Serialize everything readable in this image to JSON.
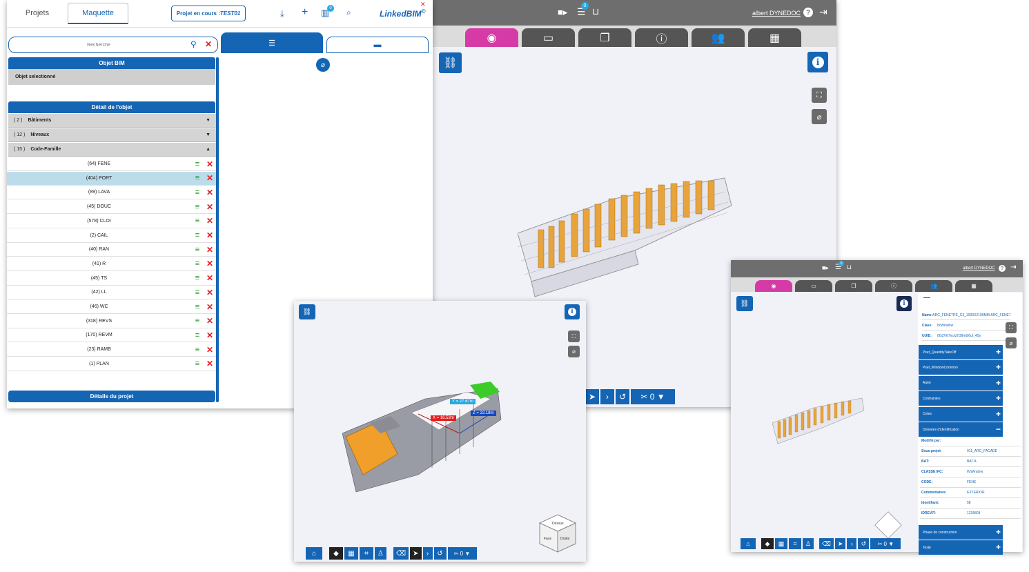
{
  "left_panel": {
    "tab_projets": "Projets",
    "tab_maquette": "Maquette",
    "current_project_label": "Projet en cours : ",
    "current_project_value": "TEST01",
    "model_badge_count": "0",
    "brand": "LinkedBIM",
    "brand_mark": "©",
    "search_placeholder": "Recherche",
    "objet_bim_header": "Objet BIM",
    "objet_selectionne": "Objet selectionné",
    "detail_header": "Détail de l'objet",
    "groups": [
      {
        "count": "( 2 )",
        "label": "Bâtiments",
        "caret": "▼"
      },
      {
        "count": "( 12 )",
        "label": "Niveaux",
        "caret": "▼"
      },
      {
        "count": "( 15 )",
        "label": "Code-Famille",
        "caret": "▲"
      }
    ],
    "families": [
      "(64) FENE",
      "(404) PORT",
      "(89) LAVA",
      "(45) DOUC",
      "(578) CLOI",
      "(2) CAIL",
      "(40) RAN",
      "(41) R",
      "(45) TS",
      "(42) LL",
      "(46) WC",
      "(318) REVS",
      "(170) REVM",
      "(23) RAMB",
      "(1) PLAN"
    ],
    "selected_family_index": 1,
    "details_projet": "Détails du projet"
  },
  "main_viewer": {
    "user_name": "albert DYNEDOC",
    "list_badge": "0",
    "counter": "0"
  },
  "front_viewer": {
    "measure_x": "X = 16.53m",
    "measure_y": "Y = 27.67m",
    "measure_z": "Z = 22.18m",
    "counter": "0",
    "cube_labels": [
      "Dessus",
      "Face",
      "Droite"
    ]
  },
  "right_viewer": {
    "user_name": "albert DYNEDOC",
    "list_badge": "0",
    "counter": "0",
    "props": [
      {
        "k": "Name:",
        "v": "ARC_FENETRE_C3_1000X2100MM:ARC_FENETR"
      },
      {
        "k": "Class:",
        "v": "IfcWindow"
      },
      {
        "k": "UUID:",
        "v": "0GZV67mJv2O8mG6ul_4Sy"
      }
    ],
    "sections": [
      "Pset_QuantityTakeOff",
      "Pset_WindowCommon",
      "Autre",
      "Contraintes",
      "Cotes",
      "Données d'identification"
    ],
    "id_rows": [
      {
        "k": "Modifié par:",
        "v": ""
      },
      {
        "k": "Sous-projet:",
        "v": "011_ARC_FACADE"
      },
      {
        "k": "BAT:",
        "v": "BAT A"
      },
      {
        "k": "CLASSE IFC:",
        "v": "IfcWindow"
      },
      {
        "k": "CODE:",
        "v": "FENE"
      },
      {
        "k": "Commentaires:",
        "v": "EXTERIOR"
      },
      {
        "k": "Identifiant:",
        "v": "58"
      },
      {
        "k": "IDREVIT:",
        "v": "1235803"
      }
    ],
    "bottom_sections": [
      "Phase de construction",
      "Texte"
    ]
  },
  "colors": {
    "primary": "#1565b5",
    "accent": "#d63aa6",
    "filter": "#29a329",
    "delete": "#e02020"
  }
}
